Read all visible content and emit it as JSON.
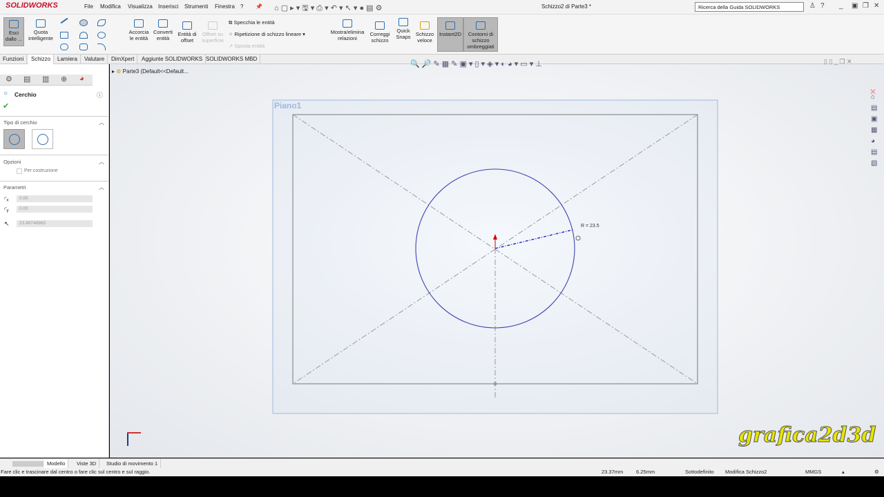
{
  "app": {
    "logo": "SOLIDWORKS",
    "title": "Schizzo2 di Parte3 *",
    "help_search": "Ricerca della Guida SOLIDWORKS"
  },
  "menu": [
    "File",
    "Modifica",
    "Visualizza",
    "Inserisci",
    "Strumenti",
    "Finestra",
    "?"
  ],
  "ribbon": {
    "exit_sketch": "Esci dallo ...",
    "smart_dim": "Quota intelligente",
    "trim": "Accorcia le entità",
    "convert": "Converti entità",
    "offset": "Entità di offset",
    "offset_surface": "Offset su superficie",
    "mirror": "Specchia le entità",
    "linear_pattern": "Ripetizione di schizzo lineare",
    "move": "Sposta entità",
    "relations": "Mostra/elimina relazioni",
    "repair": "Correggi schizzo",
    "quick_snaps": "Quick Snaps",
    "rapid_sketch": "Schizzo veloce",
    "instant2d": "Instant2D",
    "shaded": "Contorni di schizzo ombreggiati"
  },
  "tabs": [
    "Funzioni",
    "Schizzo",
    "Lamiera",
    "Valutare",
    "DimXpert",
    "Aggiunte SOLIDWORKS",
    "SOLIDWORKS MBD"
  ],
  "tree": {
    "root": "Parte3  (Default<<Default..."
  },
  "panel": {
    "title": "Cerchio",
    "circle_type": "Tipo di cerchio",
    "options": "Opzioni",
    "construction": "Per costruzione",
    "params": "Parametri",
    "cx": "0.00",
    "cy": "0.00",
    "radius": "23.49748965"
  },
  "sketch": {
    "plane": "Piano1",
    "radius_label": "R = 23.5"
  },
  "watermark": "grafica2d3d",
  "bottom_tabs": [
    "Modello",
    "Viste 3D",
    "Studio di movimento 1"
  ],
  "status": {
    "hint": "Fare clic e trascinare dal centro o fare clic sul centro e sul raggio.",
    "x": "23.37mm",
    "y": "6.25mm",
    "state": "Sottodefinito",
    "editing": "Modifica Schizzo2",
    "units": "MMGS"
  },
  "colors": {
    "circle": "#4040b0",
    "plane": "#9fb8e0",
    "origin": "#cc0000"
  }
}
